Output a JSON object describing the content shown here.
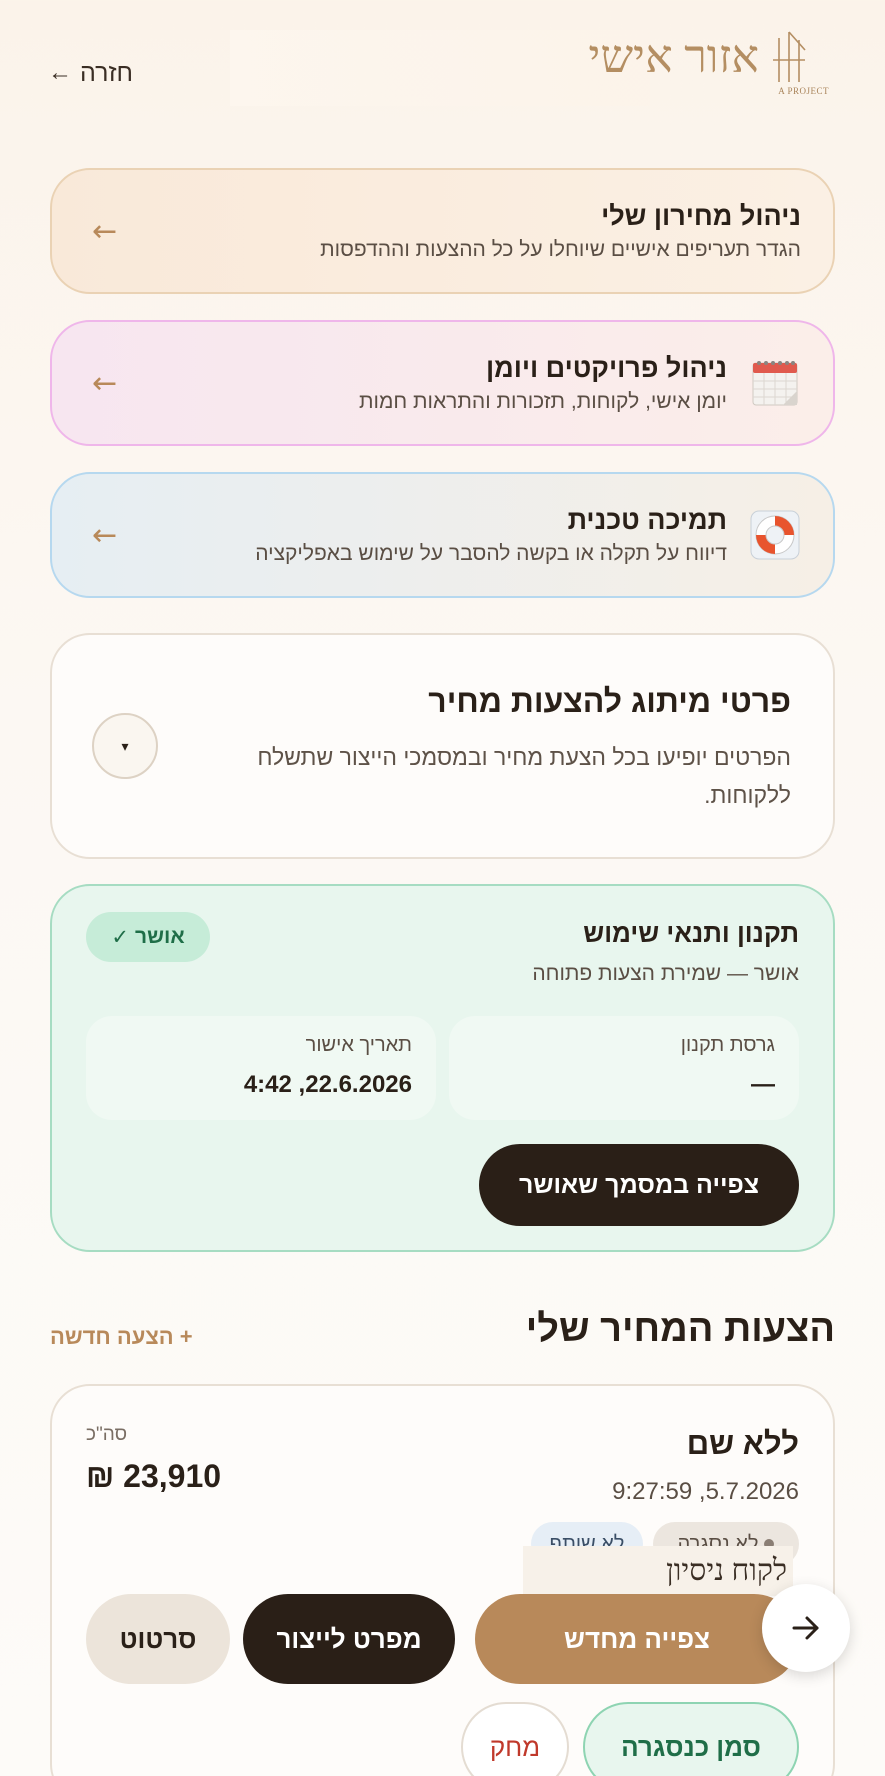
{
  "header": {
    "back_label": "חזרה",
    "logo_title": "אזור אישי",
    "logo_sub": "A PROJECT"
  },
  "menu": [
    {
      "title": "ניהול מחירון שלי",
      "desc": "הגדר תעריפים אישיים שיוחלו על כל ההצעות וההדפסות",
      "icon": "none"
    },
    {
      "title": "ניהול פרויקטים ויומן",
      "desc": "יומן אישי, לקוחות, תזכורות והתראות חמות",
      "icon": "calendar-icon"
    },
    {
      "title": "תמיכה טכנית",
      "desc": "דיווח על תקלה או בקשה להסבר על שימוש באפליקציה",
      "icon": "lifebuoy-icon"
    }
  ],
  "branding": {
    "title": "פרטי מיתוג להצעות מחיר",
    "desc": "הפרטים יופיעו בכל הצעת מחיר ובמסמכי הייצור שתשלח ללקוחות.",
    "toggle_symbol": "▾"
  },
  "terms": {
    "title": "תקנון ותנאי שימוש",
    "status": "אושר — שמירת הצעות פתוחה",
    "badge": "אושר",
    "version_label": "גרסת תקנון",
    "version_value": "—",
    "date_label": "תאריך אישור",
    "date_value": "22.6.2026, 4:42",
    "view_button": "צפייה במסמך שאושר"
  },
  "quotes": {
    "heading": "הצעות המחיר שלי",
    "new_quote": "+ הצעה חדשה",
    "items": [
      {
        "name": "ללא שם",
        "date": "5.7.2026, 9:27:59",
        "total_label": "סה\"כ",
        "total_value": "₪ 23,910",
        "chip_closed": "לא נסגרה",
        "chip_shared": "לא שותף",
        "trial_label": "לקוח ניסיון",
        "btn_view": "צפייה מחדש",
        "btn_spec": "מפרט לייצור",
        "btn_draft": "סרטוט",
        "btn_mark": "סמן כנסגרה",
        "btn_delete": "מחק"
      }
    ]
  },
  "colors": {
    "accent": "#b8895a",
    "dark": "#2a1f17",
    "success": "#1f6e48"
  }
}
